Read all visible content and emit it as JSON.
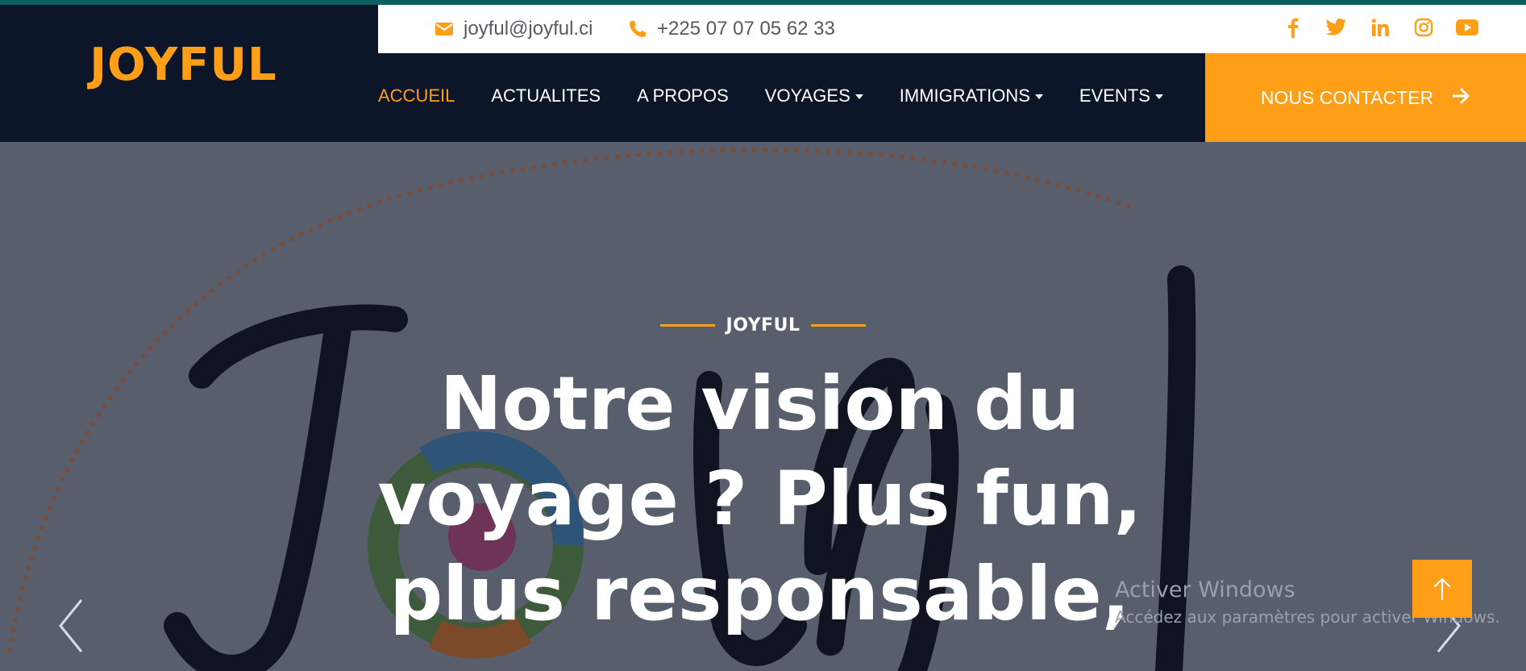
{
  "brand": {
    "name": "JOYFUL"
  },
  "topbar": {
    "email": "joyful@joyful.ci",
    "phone": "+225 07 07 05 62 33",
    "socials": [
      "facebook-icon",
      "twitter-icon",
      "linkedin-icon",
      "instagram-icon",
      "youtube-icon"
    ]
  },
  "nav": {
    "items": [
      {
        "label": "ACCUEIL",
        "active": true,
        "dropdown": false
      },
      {
        "label": "ACTUALITES",
        "active": false,
        "dropdown": false
      },
      {
        "label": "A PROPOS",
        "active": false,
        "dropdown": false
      },
      {
        "label": "VOYAGES",
        "active": false,
        "dropdown": true
      },
      {
        "label": "IMMIGRATIONS",
        "active": false,
        "dropdown": true
      },
      {
        "label": "EVENTS",
        "active": false,
        "dropdown": true
      }
    ],
    "cta_label": "NOUS CONTACTER"
  },
  "hero": {
    "eyebrow": "JOYFUL",
    "headline": "Notre vision du voyage ? Plus fun, plus responsable,"
  },
  "watermark": {
    "line1": "Activer Windows",
    "line2": "Accédez aux paramètres pour activer Windows."
  },
  "colors": {
    "accent": "#ff9f18",
    "navy": "#0d1628",
    "hero_overlay": "#595e6c",
    "top_stripe": "#0f5e5f"
  }
}
